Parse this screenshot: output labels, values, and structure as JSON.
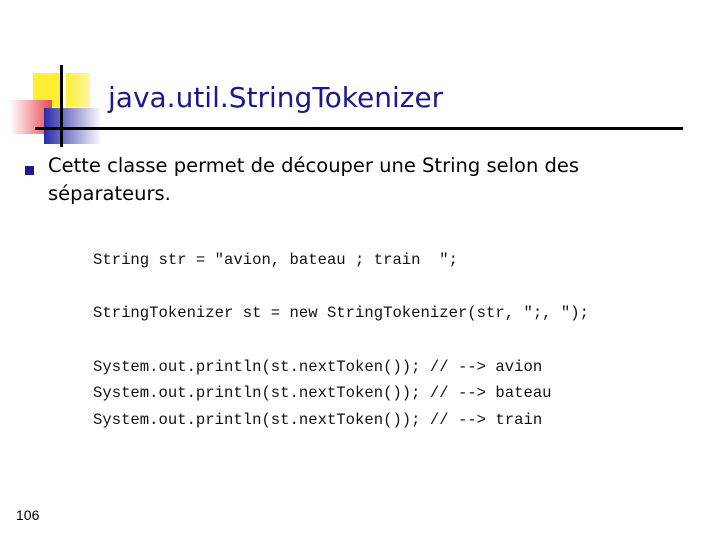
{
  "slide": {
    "title": "java.util.StringTokenizer",
    "bullet_text": "Cette classe permet de découper une String selon des séparateurs.",
    "code_lines": [
      "String str = \"avion, bateau ; train  \";",
      "StringTokenizer st = new StringTokenizer(str, \";, \");",
      "System.out.println(st.nextToken()); // --> avion",
      "System.out.println(st.nextToken()); // --> bateau",
      "System.out.println(st.nextToken()); // --> train"
    ],
    "page_number": "106"
  },
  "colors": {
    "title": "#1a1a8c",
    "bullet": "#1a1a8c",
    "logo_yellow": "#ffee33",
    "logo_red": "#e84a55",
    "logo_blue": "#3a3ab8"
  },
  "icons": {
    "logo": "colored-squares-logo",
    "bullet": "square-bullet"
  }
}
